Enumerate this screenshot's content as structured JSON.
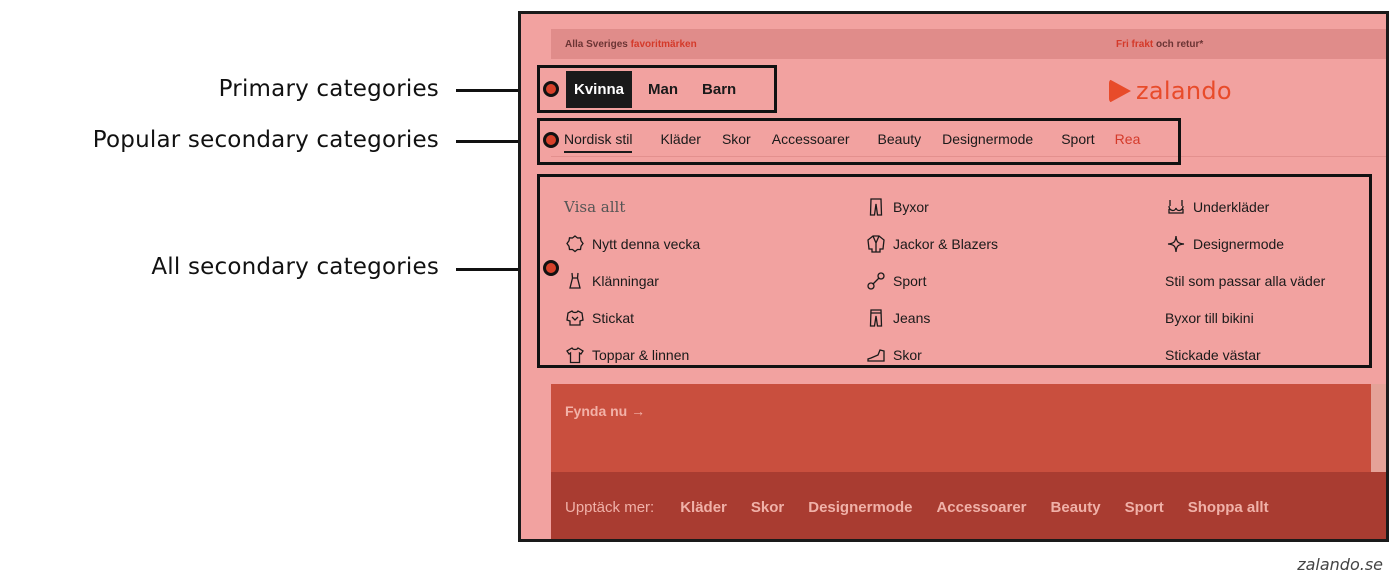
{
  "annotations": {
    "primary": "Primary categories",
    "popular_secondary": "Popular secondary categories",
    "all_secondary": "All secondary categories",
    "marker_color": "#d6412a"
  },
  "topbar": {
    "left_prefix": "Alla Sveriges",
    "left_accent": "favoritmärken",
    "right_accent": "Fri frakt",
    "right_suffix": "och retur*"
  },
  "logo": {
    "text": "zalando",
    "color": "#e84b2a",
    "icon": "zalando-logo-icon"
  },
  "primary_nav": [
    "Kvinna",
    "Man",
    "Barn"
  ],
  "secondary_nav": [
    "Nordisk stil",
    "Kläder",
    "Skor",
    "Accessoarer",
    "Beauty",
    "Designermode",
    "Sport",
    "Rea"
  ],
  "categories": {
    "col1": {
      "visa_allt": "Visa allt",
      "items": [
        {
          "label": "Nytt denna vecka",
          "icon": "badge-icon"
        },
        {
          "label": "Klänningar",
          "icon": "dress-icon"
        },
        {
          "label": "Stickat",
          "icon": "sweater-icon"
        },
        {
          "label": "Toppar & linnen",
          "icon": "tshirt-icon"
        }
      ]
    },
    "col2": [
      {
        "label": "Byxor",
        "icon": "trousers-icon"
      },
      {
        "label": "Jackor & Blazers",
        "icon": "jacket-icon"
      },
      {
        "label": "Sport",
        "icon": "dumbbell-icon"
      },
      {
        "label": "Jeans",
        "icon": "jeans-icon"
      },
      {
        "label": "Skor",
        "icon": "shoe-icon"
      }
    ],
    "col3": [
      {
        "label": "Underkläder",
        "icon": "bra-icon"
      },
      {
        "label": "Designermode",
        "icon": "sparkle-icon"
      },
      {
        "label": "Stil som passar alla väder"
      },
      {
        "label": "Byxor till bikini"
      },
      {
        "label": "Stickade västar"
      }
    ]
  },
  "promo": {
    "cta": "Fynda nu →"
  },
  "discover": {
    "label": "Upptäck mer:",
    "links": [
      "Kläder",
      "Skor",
      "Designermode",
      "Accessoarer",
      "Beauty",
      "Sport",
      "Shoppa allt"
    ]
  },
  "caption": "zalando.se",
  "colors": {
    "page_pink": "#f2a2a0",
    "sale_red": "#d43a2a",
    "promo_red": "#c94f3e",
    "discover_red": "#a93c31"
  }
}
